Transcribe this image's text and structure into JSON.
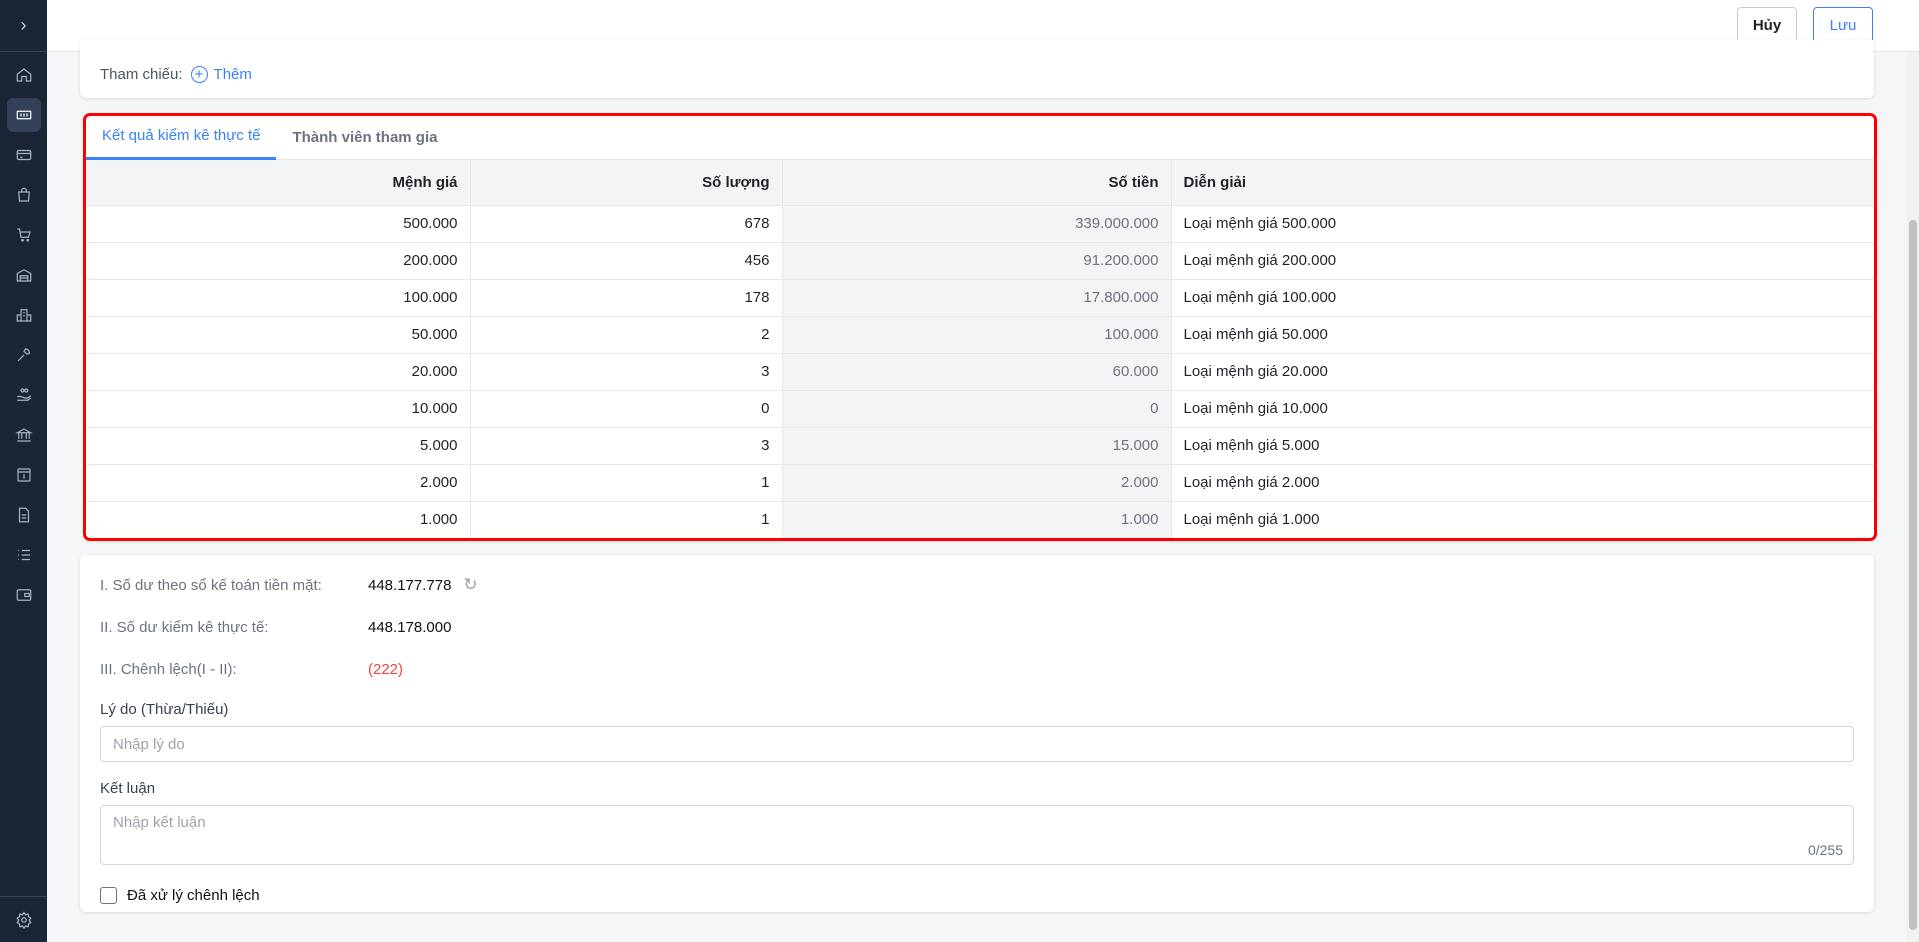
{
  "sidebar": {
    "toggle_icon": "chevron-right",
    "items": [
      "home",
      "cash-register",
      "credit-card",
      "shopping-bag",
      "cart",
      "warehouse",
      "buildings",
      "tools",
      "hand-coins",
      "bank",
      "invoice",
      "document",
      "list",
      "wallet"
    ],
    "settings_icon": "gear"
  },
  "toolbar": {
    "cancel_label": "Hủy",
    "save_label": "Lưu"
  },
  "reference": {
    "label": "Tham chiếu:",
    "add_label": "Thêm"
  },
  "tabs": [
    {
      "label": "Kết quả kiểm kê thực tế",
      "active": true
    },
    {
      "label": "Thành viên tham gia",
      "active": false
    }
  ],
  "table": {
    "headers": [
      "Mệnh giá",
      "Số lượng",
      "Số tiền",
      "Diễn giải"
    ],
    "rows": [
      [
        "500.000",
        "678",
        "339.000.000",
        "Loại mệnh giá 500.000"
      ],
      [
        "200.000",
        "456",
        "91.200.000",
        "Loại mệnh giá 200.000"
      ],
      [
        "100.000",
        "178",
        "17.800.000",
        "Loại mệnh giá 100.000"
      ],
      [
        "50.000",
        "2",
        "100.000",
        "Loại mệnh giá 50.000"
      ],
      [
        "20.000",
        "3",
        "60.000",
        "Loại mệnh giá 20.000"
      ],
      [
        "10.000",
        "0",
        "0",
        "Loại mệnh giá 10.000"
      ],
      [
        "5.000",
        "3",
        "15.000",
        "Loại mệnh giá 5.000"
      ],
      [
        "2.000",
        "1",
        "2.000",
        "Loại mệnh giá 2.000"
      ],
      [
        "1.000",
        "1",
        "1.000",
        "Loại mệnh giá 1.000"
      ]
    ]
  },
  "summary": {
    "book_label": "I. Số dư theo sổ kế toán tiền mặt:",
    "book_value": "448.177.778",
    "actual_label": "II. Số dư kiểm kê thực tế:",
    "actual_value": "448.178.000",
    "diff_label": "III. Chênh lệch(I - II):",
    "diff_value": "(222)",
    "reason_label": "Lý do (Thừa/Thiếu)",
    "reason_placeholder": "Nhập lý do",
    "conclusion_label": "Kết luận",
    "conclusion_placeholder": "Nhập kết luận",
    "conclusion_count": "0/255",
    "handled_label": "Đã xử lý chênh lệch"
  }
}
